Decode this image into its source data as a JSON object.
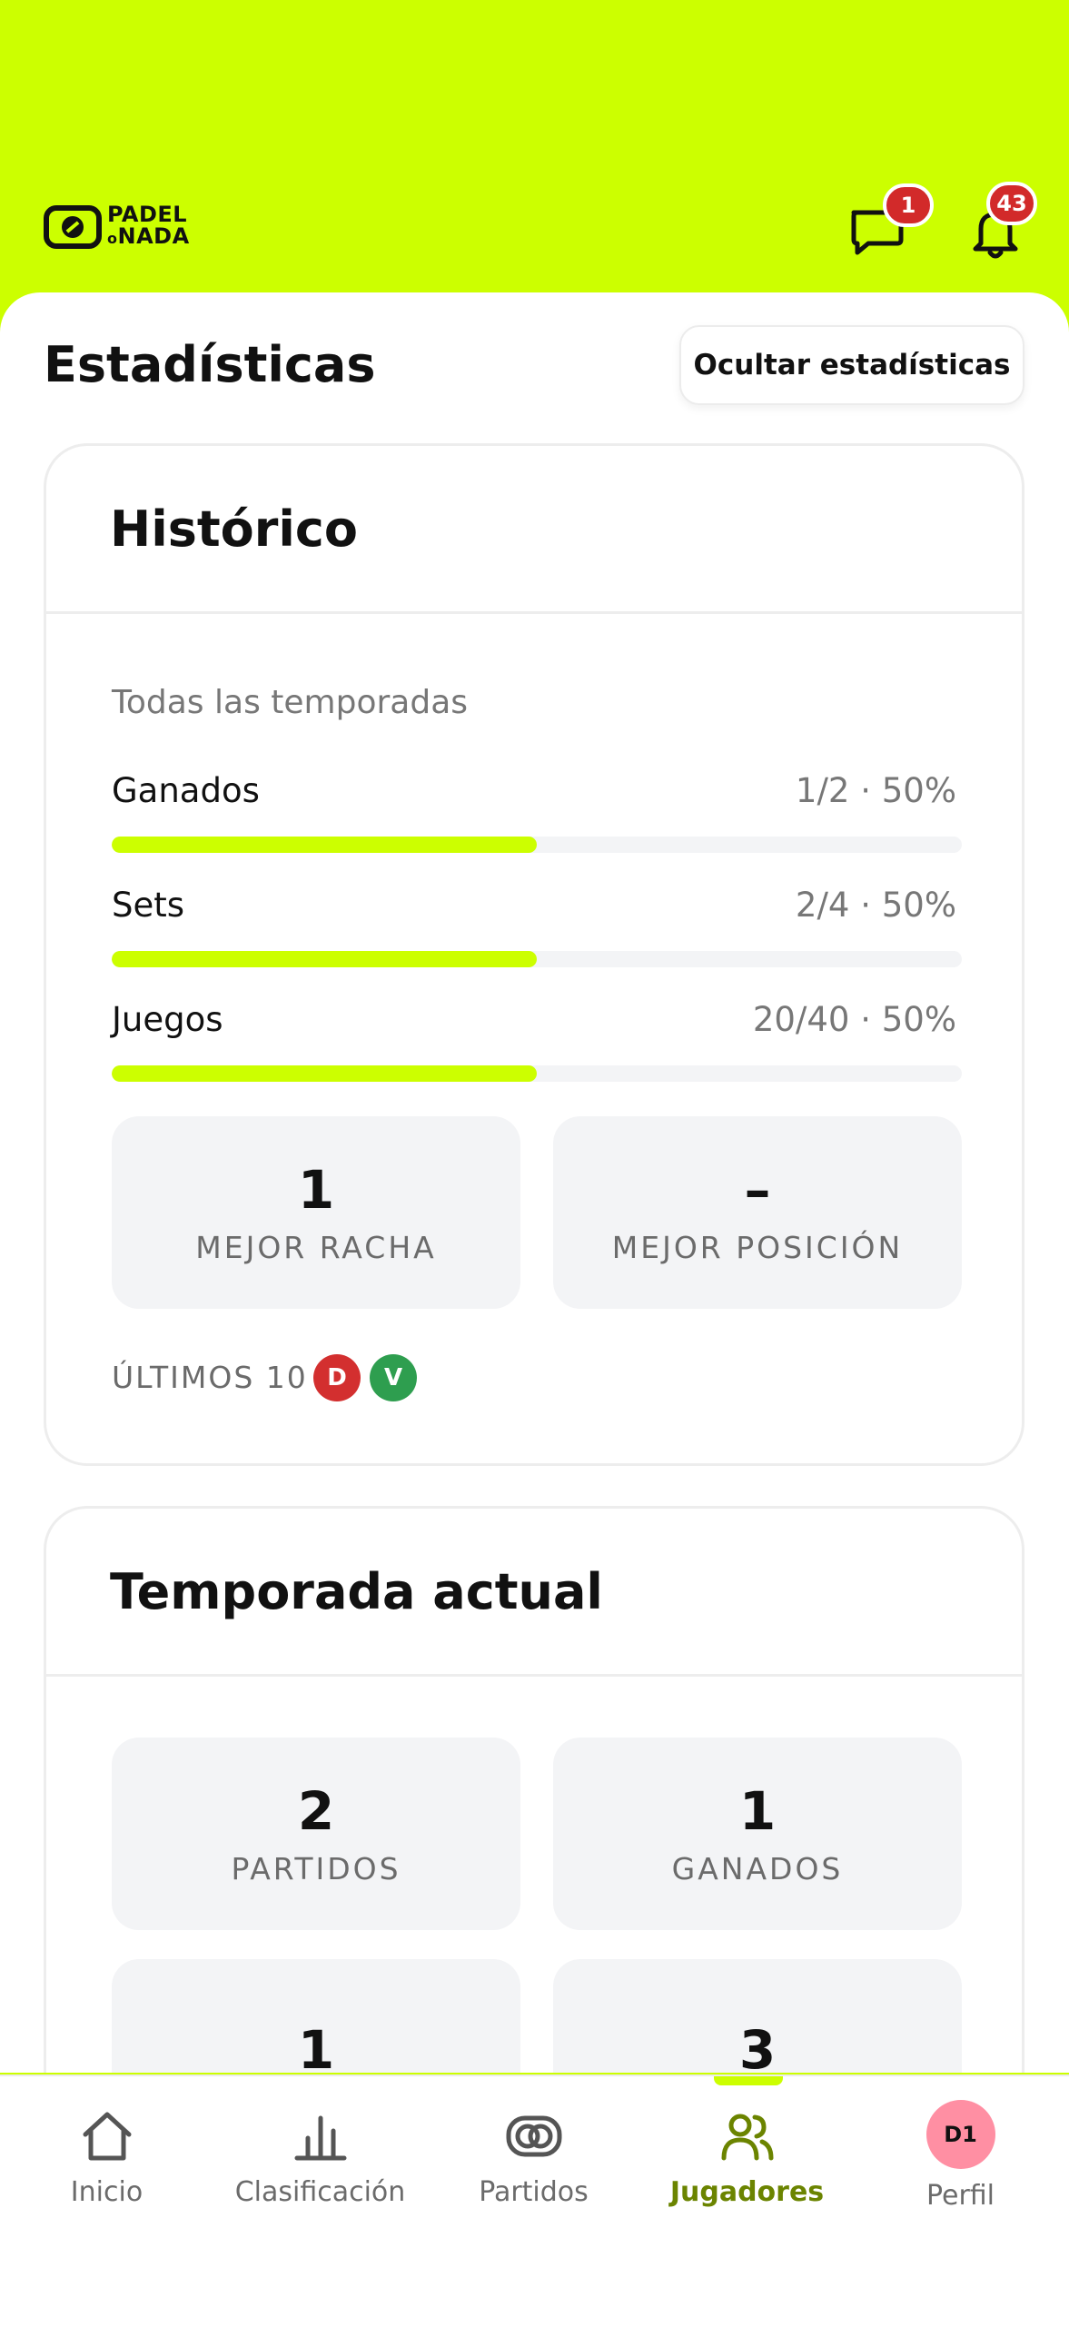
{
  "header": {
    "logo_line1": "PADEL",
    "logo_o": "o",
    "logo_line2": "NADA",
    "messages_badge": "1",
    "notifications_badge": "43"
  },
  "page": {
    "title": "Estadísticas",
    "hide_button": "Ocultar estadísticas"
  },
  "historico": {
    "title": "Histórico",
    "subtitle": "Todas las temporadas",
    "rows": [
      {
        "label": "Ganados",
        "value": "1/2 · 50%",
        "fraction": 0.5
      },
      {
        "label": "Sets",
        "value": "2/4 · 50%",
        "fraction": 0.5
      },
      {
        "label": "Juegos",
        "value": "20/40 · 50%",
        "fraction": 0.5
      }
    ],
    "tiles": [
      {
        "value": "1",
        "label": "MEJOR RACHA"
      },
      {
        "value": "–",
        "label": "MEJOR POSICIÓN"
      }
    ],
    "last10_label": "ÚLTIMOS 10",
    "last10": [
      {
        "result": "D",
        "color": "#d32f2f"
      },
      {
        "result": "V",
        "color": "#2e9e4f"
      }
    ]
  },
  "temporada": {
    "title": "Temporada actual",
    "tiles": [
      {
        "value": "2",
        "label": "PARTIDOS"
      },
      {
        "value": "1",
        "label": "GANADOS"
      },
      {
        "value": "1",
        "label": ""
      },
      {
        "value": "3",
        "label": ""
      }
    ]
  },
  "nav": {
    "items": [
      {
        "label": "Inicio",
        "icon": "home-icon"
      },
      {
        "label": "Clasificación",
        "icon": "bar-chart-icon"
      },
      {
        "label": "Partidos",
        "icon": "match-icon"
      },
      {
        "label": "Jugadores",
        "icon": "players-icon",
        "active": true
      },
      {
        "label": "Perfil",
        "icon": "avatar"
      }
    ],
    "avatar_initials": "D1"
  },
  "colors": {
    "accent": "#ccff00",
    "active_text": "#6b8400",
    "badge": "#d22a2a"
  }
}
